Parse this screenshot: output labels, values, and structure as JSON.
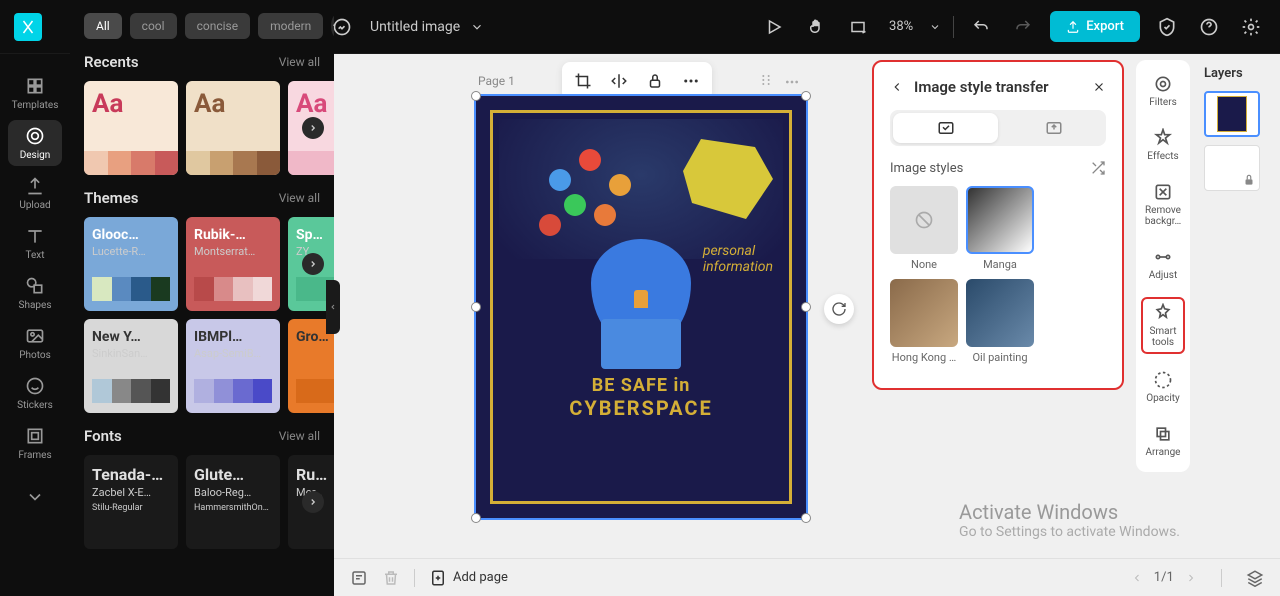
{
  "header": {
    "title": "Untitled image",
    "zoom": "38%",
    "export": "Export"
  },
  "filters": [
    "All",
    "cool",
    "concise",
    "modern"
  ],
  "leftnav": [
    {
      "label": "Templates"
    },
    {
      "label": "Design"
    },
    {
      "label": "Upload"
    },
    {
      "label": "Text"
    },
    {
      "label": "Shapes"
    },
    {
      "label": "Photos"
    },
    {
      "label": "Stickers"
    },
    {
      "label": "Frames"
    }
  ],
  "sections": {
    "recents": {
      "title": "Recents",
      "link": "View all"
    },
    "themes": {
      "title": "Themes",
      "link": "View all",
      "items": [
        {
          "name": "Glooc…",
          "sub": "Lucette-R…",
          "bg": "#7aa8d8",
          "colors": [
            "#d8e8c0",
            "#5a8ac0",
            "#2a5a8a",
            "#1a3a20"
          ]
        },
        {
          "name": "Rubik-…",
          "sub": "Montserrat…",
          "bg": "#c85a5a",
          "colors": [
            "#b84a4a",
            "#d88a8a",
            "#e8c0c0",
            "#f0d8d8"
          ]
        },
        {
          "name": "Sp…",
          "sub": "ZY…",
          "bg": "#5ac89a",
          "colors": [
            "#4ab88a"
          ]
        },
        {
          "name": "New Y…",
          "sub": "SinkinSan…",
          "bg": "#d8d8d8",
          "colors": [
            "#b0c8d8",
            "#888",
            "#555",
            "#333"
          ]
        },
        {
          "name": "IBMPl…",
          "sub": "Asap-SemiB…",
          "bg": "#c8c8e8",
          "colors": [
            "#b0b0e0",
            "#9090d8",
            "#6a6ad0",
            "#4a4ac8"
          ]
        },
        {
          "name": "Gro…",
          "sub": "",
          "bg": "#e87a2a",
          "colors": [
            "#d86a1a"
          ]
        }
      ]
    },
    "fonts": {
      "title": "Fonts",
      "link": "View all",
      "items": [
        {
          "name": "Tenada-…",
          "sub": "Zacbel X-E…",
          "sub2": "Stilu-Regular"
        },
        {
          "name": "Glute…",
          "sub": "Baloo-Reg…",
          "sub2": "HammersmithOn…"
        },
        {
          "name": "Ru…",
          "sub": "Mor…"
        }
      ]
    }
  },
  "recentCards": [
    {
      "bg": "#f8e8d8",
      "aa": "#c83a5a",
      "colors": [
        "#f0c8b0",
        "#e8a080",
        "#d87a6a",
        "#c85a5a"
      ]
    },
    {
      "bg": "#f0e0c8",
      "aa": "#8a5a3a",
      "colors": [
        "#e0c8a0",
        "#c8a070",
        "#a87850",
        "#8a5a3a"
      ]
    },
    {
      "bg": "#f8d8e0",
      "aa": "#d84a7a",
      "colors": [
        "#f0b8c8"
      ]
    }
  ],
  "canvas": {
    "page": "Page 1",
    "poster": {
      "line1": "BE SAFE in",
      "line2": "CYBERSPACE",
      "pinfo": "personal\ninformation"
    }
  },
  "stylepanel": {
    "title": "Image style transfer",
    "section": "Image styles",
    "items": [
      {
        "label": "None"
      },
      {
        "label": "Manga",
        "sel": true
      },
      {
        "label": "Hong Kong …"
      },
      {
        "label": "Oil painting"
      }
    ]
  },
  "rightrail": [
    {
      "label": "Filters"
    },
    {
      "label": "Effects"
    },
    {
      "label": "Remove\nbackgr…"
    },
    {
      "label": "Adjust"
    },
    {
      "label": "Smart\ntools",
      "hl": true
    },
    {
      "label": "Opacity"
    },
    {
      "label": "Arrange"
    }
  ],
  "layers": {
    "title": "Layers"
  },
  "bottombar": {
    "addpage": "Add page",
    "pages": "1/1"
  },
  "watermark": {
    "title": "Activate Windows",
    "sub": "Go to Settings to activate Windows."
  }
}
